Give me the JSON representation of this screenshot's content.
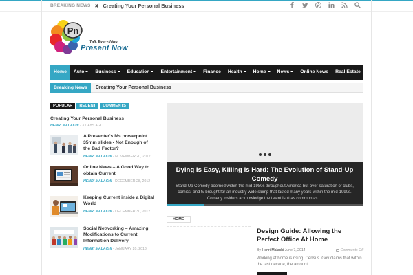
{
  "topbar": {
    "breaking_label": "BREAKING NEWS",
    "separator": "✖",
    "breaking_title": "Creating Your Personal Business",
    "social_icons": [
      "facebook-icon",
      "twitter-icon",
      "pinterest-icon",
      "linkedin-icon",
      "rss-icon",
      "search-icon"
    ]
  },
  "logo": {
    "monogram": "Pn",
    "tagline": "Talk Everything",
    "name": "Present Now"
  },
  "nav": {
    "items": [
      {
        "label": "Home",
        "dropdown": false,
        "active": true
      },
      {
        "label": "Auto",
        "dropdown": true
      },
      {
        "label": "Business",
        "dropdown": true
      },
      {
        "label": "Education",
        "dropdown": true
      },
      {
        "label": "Entertainment",
        "dropdown": true
      },
      {
        "label": "Finance",
        "dropdown": false
      },
      {
        "label": "Health",
        "dropdown": true
      },
      {
        "label": "Home",
        "dropdown": true
      },
      {
        "label": "News",
        "dropdown": true
      },
      {
        "label": "Online News",
        "dropdown": false
      },
      {
        "label": "Real Estate",
        "dropdown": false
      }
    ]
  },
  "ticker": {
    "label": "Breaking News",
    "title": "Creating Your Personal Business"
  },
  "sidebar": {
    "tabs": [
      "POPULAR",
      "RECENT",
      "COMMENTS"
    ],
    "first": {
      "title": "Creating Your Personal Business",
      "author": "HENRI MALACHI",
      "date": "3 DAYS AGO"
    },
    "items": [
      {
        "title": "A Presenter's Ms powerpoint 35mm slides • Not Enough of the Bad Factor?",
        "author": "HENRI MALACHI",
        "date": "NOVEMBER 20, 2012"
      },
      {
        "title": "Online News – A Good Way to obtain Current",
        "author": "HENRI MALACHI",
        "date": "DECEMBER 28, 2012"
      },
      {
        "title": "Keeping Current inside a Digital World",
        "author": "HENRI MALACHI",
        "date": "DECEMBER 30, 2012"
      },
      {
        "title": "Social Networking – Amazing Modifications to Current Information Delivery",
        "author": "HENRI MALACHI",
        "date": "JANUARY 20, 2013"
      }
    ]
  },
  "slider": {
    "title": "Dying Is Easy, Killing Is Hard: The Evolution of Stand-Up Comedy",
    "excerpt": "Stand-Up Comedy boomed within the mid-1980s throughout America but over-saturation of clubs, comics, and tv brought for an industry-wide slump that lasted many years within the mid-1990s. Comedy insiders acknowledge the talent isn't as common as ...",
    "progress": 0.19,
    "dots": 3
  },
  "section": {
    "label": "HOME"
  },
  "post": {
    "title": "Design Guide: Allowing the Perfect Office At Home",
    "by": "By",
    "author": "Henri Malachi",
    "date": "June 7, 2014",
    "comments": "Comments Off",
    "excerpt": "Working at home is rising. Census. Gov claims that within the last decade, the amount ..."
  },
  "colors": {
    "accent": "#35a7c4",
    "nav_bg": "#191919"
  }
}
